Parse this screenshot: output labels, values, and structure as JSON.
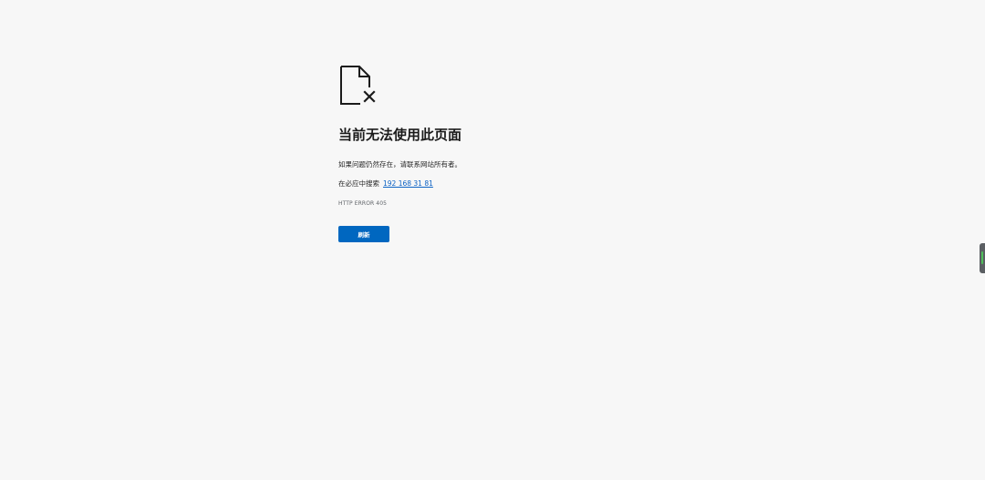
{
  "error_page": {
    "icon": "broken-document-icon",
    "title": "当前无法使用此页面",
    "description": "如果问题仍然存在，请联系网站所有者。",
    "search_prefix": "在必应中搜索",
    "search_link": "192 168 31 81",
    "error_code": "HTTP ERROR 405",
    "refresh_label": "刷新"
  },
  "colors": {
    "background": "#f7f7f7",
    "button": "#0067c0",
    "link": "#0b62c4"
  }
}
